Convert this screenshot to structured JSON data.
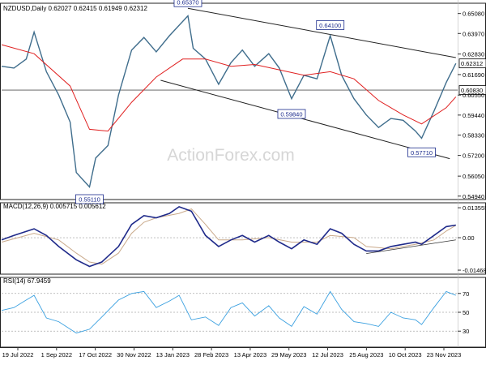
{
  "chart_data": [
    {
      "type": "line",
      "panel": "price",
      "title": "NZDUSD,Daily  0.62027 0.62415 0.61949 0.62312",
      "y_ticks": [
        "0.65080",
        "0.63970",
        "0.62830",
        "0.61690",
        "0.60550",
        "0.59440",
        "0.58330",
        "0.57200",
        "0.56050",
        "0.54940"
      ],
      "ylim": [
        0.5475,
        0.6565
      ],
      "x_ticks": [
        "19 Jul 2022",
        "1 Sep 2022",
        "17 Oct 2022",
        "30 Nov 2022",
        "13 Jan 2023",
        "28 Feb 2023",
        "13 Apr 2023",
        "29 May 2023",
        "12 Jul 2023",
        "25 Aug 2023",
        "10 Oct 2023",
        "23 Nov 2023"
      ],
      "current_price_label": "0.62312",
      "horizontal_line_label": "0.60830",
      "horizontal_line_value": 0.6083,
      "annotations": [
        {
          "text": "0.65370",
          "date": "2023-02-02",
          "value": 0.6537
        },
        {
          "text": "0.64100",
          "date": "2023-07-14",
          "value": 0.641
        },
        {
          "text": "0.59840",
          "date": "2023-05-31",
          "value": 0.5984
        },
        {
          "text": "0.57710",
          "date": "2023-10-26",
          "value": 0.5771
        },
        {
          "text": "0.55110",
          "date": "2022-10-13",
          "value": 0.5511
        }
      ],
      "series": [
        {
          "style": "close",
          "points": [
            [
              "2022-07-05",
              0.6215
            ],
            [
              "2022-07-19",
              0.6205
            ],
            [
              "2022-08-02",
              0.6255
            ],
            [
              "2022-08-11",
              0.6405
            ],
            [
              "2022-08-25",
              0.6185
            ],
            [
              "2022-09-08",
              0.6055
            ],
            [
              "2022-09-21",
              0.5905
            ],
            [
              "2022-09-28",
              0.5625
            ],
            [
              "2022-10-13",
              0.5545
            ],
            [
              "2022-10-20",
              0.5705
            ],
            [
              "2022-11-03",
              0.5775
            ],
            [
              "2022-11-15",
              0.6055
            ],
            [
              "2022-11-30",
              0.6305
            ],
            [
              "2022-12-14",
              0.6375
            ],
            [
              "2022-12-28",
              0.6295
            ],
            [
              "2023-01-12",
              0.6385
            ],
            [
              "2023-02-02",
              0.6495
            ],
            [
              "2023-02-08",
              0.6315
            ],
            [
              "2023-02-22",
              0.6255
            ],
            [
              "2023-03-09",
              0.6115
            ],
            [
              "2023-03-23",
              0.6235
            ],
            [
              "2023-04-05",
              0.6305
            ],
            [
              "2023-04-19",
              0.6215
            ],
            [
              "2023-05-05",
              0.6285
            ],
            [
              "2023-05-17",
              0.6205
            ],
            [
              "2023-05-31",
              0.6035
            ],
            [
              "2023-06-14",
              0.6165
            ],
            [
              "2023-06-29",
              0.6145
            ],
            [
              "2023-07-14",
              0.6385
            ],
            [
              "2023-07-27",
              0.6165
            ],
            [
              "2023-08-10",
              0.6035
            ],
            [
              "2023-08-24",
              0.5945
            ],
            [
              "2023-09-07",
              0.5875
            ],
            [
              "2023-09-21",
              0.5925
            ],
            [
              "2023-10-05",
              0.5915
            ],
            [
              "2023-10-19",
              0.5855
            ],
            [
              "2023-10-26",
              0.5815
            ],
            [
              "2023-11-09",
              0.5965
            ],
            [
              "2023-11-23",
              0.6125
            ],
            [
              "2023-12-04",
              0.6231
            ]
          ]
        },
        {
          "style": "moving-average",
          "points": [
            [
              "2022-07-05",
              0.6335
            ],
            [
              "2022-08-11",
              0.6285
            ],
            [
              "2022-09-21",
              0.6105
            ],
            [
              "2022-10-13",
              0.5865
            ],
            [
              "2022-11-03",
              0.5855
            ],
            [
              "2022-11-30",
              0.6015
            ],
            [
              "2022-12-28",
              0.6155
            ],
            [
              "2023-01-27",
              0.6255
            ],
            [
              "2023-02-22",
              0.6255
            ],
            [
              "2023-03-23",
              0.6215
            ],
            [
              "2023-04-19",
              0.6225
            ],
            [
              "2023-05-17",
              0.6195
            ],
            [
              "2023-06-14",
              0.6165
            ],
            [
              "2023-07-14",
              0.6185
            ],
            [
              "2023-08-10",
              0.6145
            ],
            [
              "2023-09-07",
              0.6025
            ],
            [
              "2023-10-05",
              0.5945
            ],
            [
              "2023-10-26",
              0.5895
            ],
            [
              "2023-11-23",
              0.5985
            ],
            [
              "2023-12-04",
              0.6045
            ]
          ]
        }
      ],
      "trendlines": [
        {
          "points": [
            [
              "2023-02-02",
              0.6537
            ],
            [
              "2023-12-04",
              0.6263
            ]
          ]
        },
        {
          "points": [
            [
              "2023-01-02",
              0.6137
            ],
            [
              "2023-11-27",
              0.5702
            ]
          ]
        }
      ]
    },
    {
      "type": "line",
      "panel": "macd",
      "title": "MACD(12,26,9) 0.005715 0.005612",
      "y_ticks": [
        "0.013555",
        "0.00",
        "-0.014684"
      ],
      "ylim": [
        -0.0165,
        0.0158
      ],
      "series": [
        {
          "style": "macd-line",
          "points": [
            [
              "2022-07-05",
              -0.001
            ],
            [
              "2022-07-19",
              0.001
            ],
            [
              "2022-08-11",
              0.004
            ],
            [
              "2022-08-25",
              0.001
            ],
            [
              "2022-09-08",
              -0.004
            ],
            [
              "2022-09-28",
              -0.01
            ],
            [
              "2022-10-13",
              -0.013
            ],
            [
              "2022-10-27",
              -0.011
            ],
            [
              "2022-11-15",
              -0.004
            ],
            [
              "2022-11-30",
              0.006
            ],
            [
              "2022-12-14",
              0.01
            ],
            [
              "2022-12-28",
              0.009
            ],
            [
              "2023-01-12",
              0.011
            ],
            [
              "2023-01-23",
              0.014
            ],
            [
              "2023-02-06",
              0.012
            ],
            [
              "2023-02-22",
              0.001
            ],
            [
              "2023-03-09",
              -0.004
            ],
            [
              "2023-03-23",
              -0.001
            ],
            [
              "2023-04-05",
              0.001
            ],
            [
              "2023-04-19",
              -0.002
            ],
            [
              "2023-05-05",
              0.001
            ],
            [
              "2023-05-17",
              -0.002
            ],
            [
              "2023-05-31",
              -0.005
            ],
            [
              "2023-06-14",
              -0.001
            ],
            [
              "2023-06-29",
              -0.003
            ],
            [
              "2023-07-14",
              0.004
            ],
            [
              "2023-07-27",
              0.002
            ],
            [
              "2023-08-10",
              -0.003
            ],
            [
              "2023-08-24",
              -0.006
            ],
            [
              "2023-09-07",
              -0.006
            ],
            [
              "2023-09-21",
              -0.004
            ],
            [
              "2023-10-05",
              -0.003
            ],
            [
              "2023-10-19",
              -0.002
            ],
            [
              "2023-10-26",
              -0.003
            ],
            [
              "2023-11-09",
              0.001
            ],
            [
              "2023-11-23",
              0.005
            ],
            [
              "2023-12-04",
              0.0057
            ]
          ]
        },
        {
          "style": "signal-line",
          "points": [
            [
              "2022-07-05",
              -0.002
            ],
            [
              "2022-08-11",
              0.002
            ],
            [
              "2022-09-08",
              -0.001
            ],
            [
              "2022-09-28",
              -0.007
            ],
            [
              "2022-10-13",
              -0.011
            ],
            [
              "2022-10-27",
              -0.012
            ],
            [
              "2022-11-15",
              -0.007
            ],
            [
              "2022-11-30",
              0.002
            ],
            [
              "2022-12-14",
              0.007
            ],
            [
              "2022-12-28",
              0.009
            ],
            [
              "2023-01-23",
              0.011
            ],
            [
              "2023-02-06",
              0.013
            ],
            [
              "2023-02-22",
              0.006
            ],
            [
              "2023-03-09",
              -0.001
            ],
            [
              "2023-04-05",
              -0.001
            ],
            [
              "2023-05-05",
              0.0
            ],
            [
              "2023-05-31",
              -0.002
            ],
            [
              "2023-06-29",
              -0.002
            ],
            [
              "2023-07-14",
              0.001
            ],
            [
              "2023-08-10",
              -0.0
            ],
            [
              "2023-08-24",
              -0.004
            ],
            [
              "2023-09-21",
              -0.005
            ],
            [
              "2023-10-19",
              -0.003
            ],
            [
              "2023-11-09",
              -0.001
            ],
            [
              "2023-11-23",
              0.003
            ],
            [
              "2023-12-04",
              0.0056
            ]
          ]
        }
      ],
      "trendlines": [
        {
          "points": [
            [
              "2023-08-24",
              -0.0072
            ],
            [
              "2023-12-04",
              -0.001
            ]
          ]
        }
      ]
    },
    {
      "type": "line",
      "panel": "rsi",
      "title": "RSI(14) 67.9459",
      "y_ticks": [
        "70",
        "50",
        "30"
      ],
      "ylim": [
        13,
        87
      ],
      "series": [
        {
          "style": "rsi",
          "points": [
            [
              "2022-07-05",
              52
            ],
            [
              "2022-07-19",
              55
            ],
            [
              "2022-08-02",
              63
            ],
            [
              "2022-08-11",
              68
            ],
            [
              "2022-08-25",
              44
            ],
            [
              "2022-09-08",
              40
            ],
            [
              "2022-09-28",
              28
            ],
            [
              "2022-10-13",
              32
            ],
            [
              "2022-10-27",
              45
            ],
            [
              "2022-11-15",
              63
            ],
            [
              "2022-11-30",
              70
            ],
            [
              "2022-12-14",
              72
            ],
            [
              "2022-12-28",
              55
            ],
            [
              "2023-01-12",
              62
            ],
            [
              "2023-01-23",
              68
            ],
            [
              "2023-02-06",
              42
            ],
            [
              "2023-02-22",
              45
            ],
            [
              "2023-03-09",
              36
            ],
            [
              "2023-03-23",
              55
            ],
            [
              "2023-04-05",
              60
            ],
            [
              "2023-04-19",
              46
            ],
            [
              "2023-05-05",
              57
            ],
            [
              "2023-05-17",
              44
            ],
            [
              "2023-05-31",
              35
            ],
            [
              "2023-06-14",
              56
            ],
            [
              "2023-06-29",
              48
            ],
            [
              "2023-07-14",
              72
            ],
            [
              "2023-07-27",
              53
            ],
            [
              "2023-08-10",
              40
            ],
            [
              "2023-08-24",
              38
            ],
            [
              "2023-09-07",
              35
            ],
            [
              "2023-09-21",
              50
            ],
            [
              "2023-10-05",
              44
            ],
            [
              "2023-10-19",
              42
            ],
            [
              "2023-10-26",
              37
            ],
            [
              "2023-11-09",
              55
            ],
            [
              "2023-11-23",
              72
            ],
            [
              "2023-12-04",
              68
            ]
          ]
        }
      ]
    }
  ],
  "watermark": "ActionForex.com"
}
